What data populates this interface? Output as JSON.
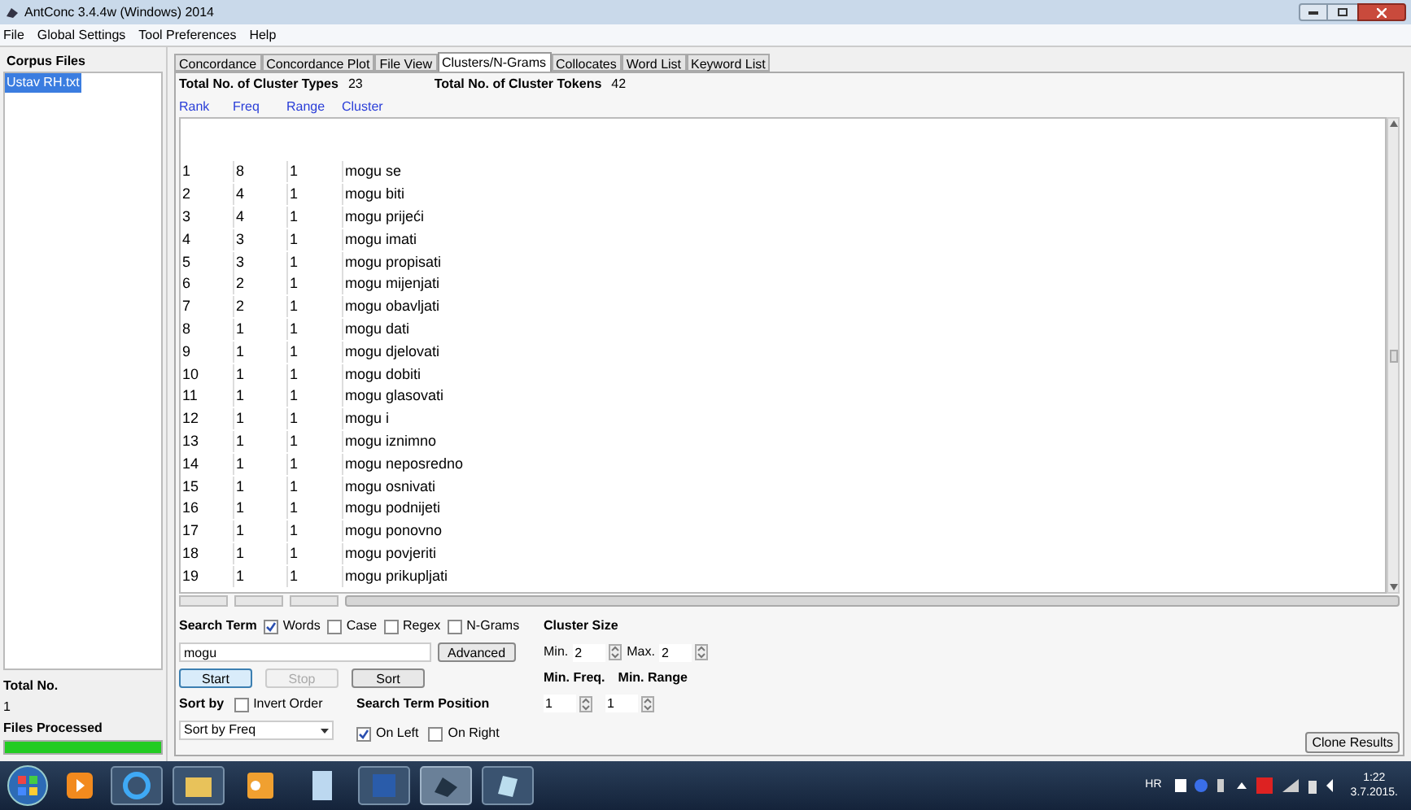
{
  "window": {
    "title": "AntConc 3.4.4w (Windows) 2014"
  },
  "menu": [
    "File",
    "Global Settings",
    "Tool Preferences",
    "Help"
  ],
  "corpus_files": {
    "title": "Corpus Files",
    "items": [
      {
        "label": "Ustav RH.txt",
        "selected": true
      }
    ]
  },
  "totals": {
    "total_label": "Total No.",
    "total_value": "1",
    "processed_label": "Files Processed",
    "level": 1
  },
  "tabs": [
    {
      "label": "Concordance",
      "selected": false
    },
    {
      "label": "Concordance Plot",
      "selected": false
    },
    {
      "label": "File View",
      "selected": false
    },
    {
      "label": "Clusters/N-Grams",
      "selected": true
    },
    {
      "label": "Collocates",
      "selected": false
    },
    {
      "label": "Word List",
      "selected": false
    },
    {
      "label": "Keyword List",
      "selected": false
    }
  ],
  "summary": [
    {
      "label": "Total No. of Cluster Types",
      "value": "23"
    },
    {
      "label": "Total No. of Cluster Tokens",
      "value": "42"
    }
  ],
  "table": {
    "columns": [
      "Rank",
      "Freq",
      "Range",
      "Cluster"
    ],
    "rows": [
      [
        "1",
        "8",
        "1",
        "mogu se"
      ],
      [
        "2",
        "4",
        "1",
        "mogu biti"
      ],
      [
        "3",
        "4",
        "1",
        "mogu prijeći"
      ],
      [
        "4",
        "3",
        "1",
        "mogu imati"
      ],
      [
        "5",
        "3",
        "1",
        "mogu propisati"
      ],
      [
        "6",
        "2",
        "1",
        "mogu mijenjati"
      ],
      [
        "7",
        "2",
        "1",
        "mogu obavljati"
      ],
      [
        "8",
        "1",
        "1",
        "mogu dati"
      ],
      [
        "9",
        "1",
        "1",
        "mogu djelovati"
      ],
      [
        "10",
        "1",
        "1",
        "mogu dobiti"
      ],
      [
        "11",
        "1",
        "1",
        "mogu glasovati"
      ],
      [
        "12",
        "1",
        "1",
        "mogu i"
      ],
      [
        "13",
        "1",
        "1",
        "mogu iznimno"
      ],
      [
        "14",
        "1",
        "1",
        "mogu neposredno"
      ],
      [
        "15",
        "1",
        "1",
        "mogu osnivati"
      ],
      [
        "16",
        "1",
        "1",
        "mogu podnijeti"
      ],
      [
        "17",
        "1",
        "1",
        "mogu ponovno"
      ],
      [
        "18",
        "1",
        "1",
        "mogu povjeriti"
      ],
      [
        "19",
        "1",
        "1",
        "mogu prikupljati"
      ]
    ]
  },
  "search": {
    "label": "Search Term",
    "options": [
      {
        "label": "Words",
        "checked": true
      },
      {
        "label": "Case",
        "checked": false
      },
      {
        "label": "Regex",
        "checked": false
      },
      {
        "label": "N-Grams",
        "checked": false
      }
    ],
    "value": "mogu",
    "advanced": "Advanced",
    "buttons": [
      {
        "label": "Start",
        "disabled": false,
        "selected": true
      },
      {
        "label": "Stop",
        "disabled": true,
        "selected": false
      },
      {
        "label": "Sort",
        "disabled": false,
        "selected": false
      }
    ]
  },
  "sort": {
    "label": "Sort by",
    "invert": {
      "label": "Invert Order",
      "checked": false
    },
    "value": "Sort by Freq"
  },
  "position": {
    "label": "Search Term Position",
    "options": [
      {
        "label": "On Left",
        "checked": true
      },
      {
        "label": "On Right",
        "checked": false
      }
    ]
  },
  "cluster_size": {
    "label": "Cluster Size",
    "min_label": "Min.",
    "min": "2",
    "max_label": "Max.",
    "max": "2"
  },
  "min_freq": {
    "label": "Min. Freq.",
    "value": "1"
  },
  "min_range": {
    "label": "Min. Range",
    "value": "1"
  },
  "clone_button": "Clone Results",
  "tray": {
    "language": "HR",
    "time": "1:22",
    "date": "3.7.2015."
  }
}
